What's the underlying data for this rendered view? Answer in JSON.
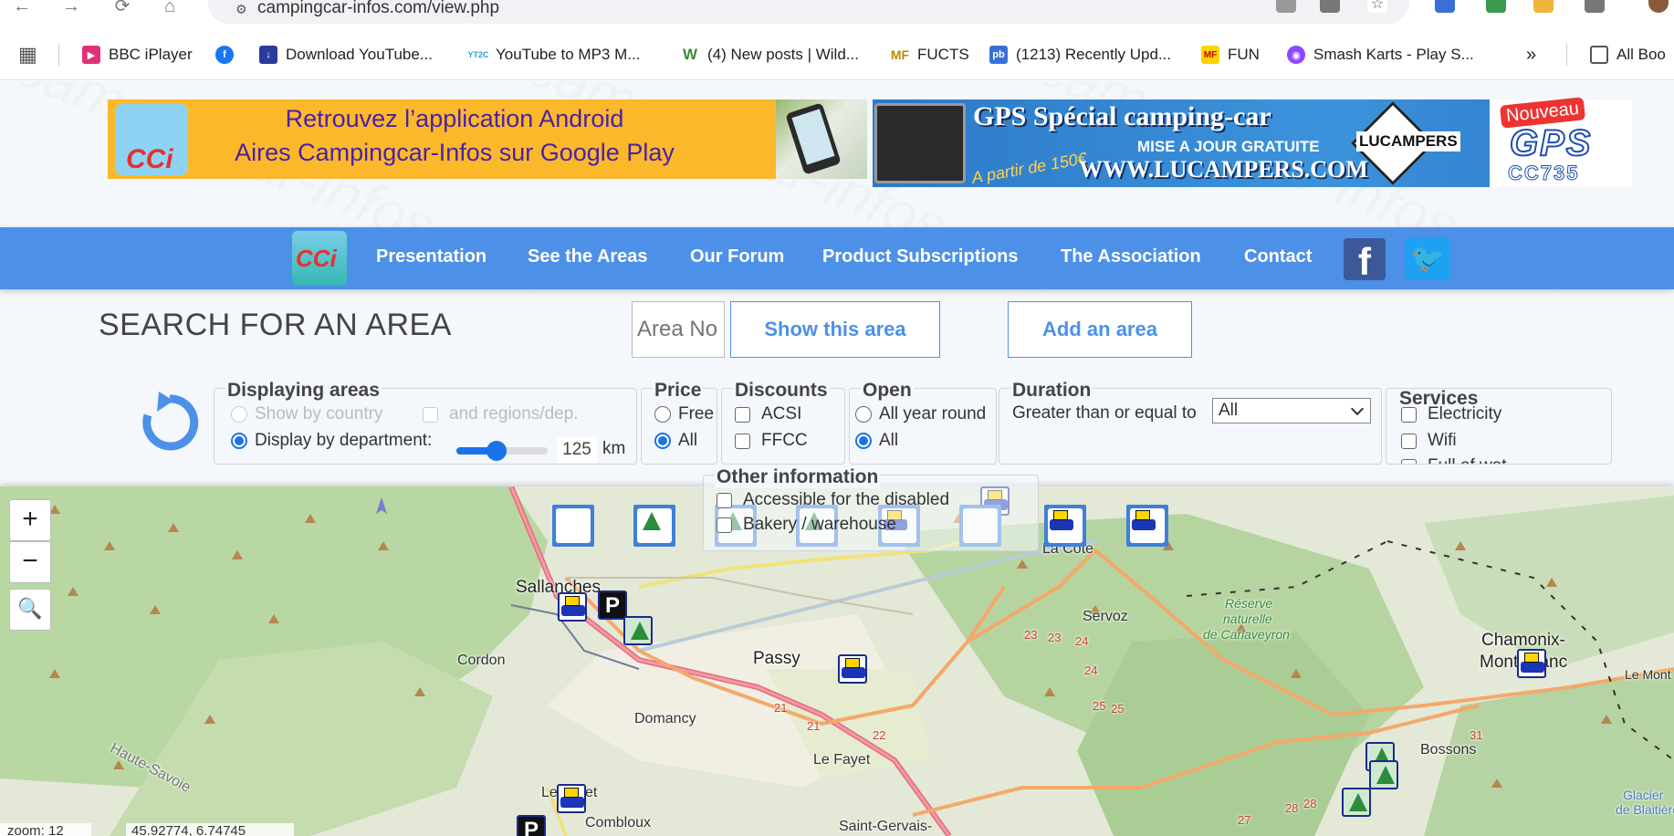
{
  "browser": {
    "url": "campingcar-infos.com/view.php",
    "bookmarks": [
      {
        "label": "BBC iPlayer",
        "icon": "bbc-iplayer-icon"
      },
      {
        "label": "Download YouTube...",
        "icon": "download-icon"
      },
      {
        "label": "YouTube to MP3 M...",
        "icon": "yt2c-icon",
        "badge": "YT2C"
      },
      {
        "label": "(4) New posts | Wild...",
        "icon": "w-icon",
        "badge": "W"
      },
      {
        "label": "FUCTS",
        "icon": "mf-icon",
        "badge": "MF"
      },
      {
        "label": "(1213) Recently Upd...",
        "icon": "pb-icon",
        "badge": "pb"
      },
      {
        "label": "FUN",
        "icon": "mf-icon",
        "badge": "MF"
      },
      {
        "label": "Smash Karts - Play S...",
        "icon": "twitch-icon"
      }
    ],
    "all_bookmarks": "All Boo"
  },
  "ads": {
    "android": {
      "line1": "Retrouvez l’application Android",
      "line2": "Aires Campingcar-Infos sur Google Play",
      "logo_text": "CCi"
    },
    "gps": {
      "title": "GPS Spécial camping-car",
      "update": "MISE A JOUR GRATUITE",
      "price": "A partir de 150€",
      "site": "WWW.LUCAMPERS.COM",
      "brand": "LUCAMPERS",
      "new": "Nouveau",
      "gps": "GPS",
      "model": "CC735"
    }
  },
  "nav": {
    "logo_text": "CCi",
    "links": [
      "Presentation",
      "See the Areas",
      "Our Forum",
      "Product Subscriptions",
      "The Association",
      "Contact"
    ],
    "facebook": "f",
    "twitter": "🐦"
  },
  "search": {
    "title": "SEARCH FOR AN AREA",
    "placeholder": "Area No",
    "show_button": "Show this area",
    "add_button": "Add an area"
  },
  "filters": {
    "displaying": {
      "legend": "Displaying areas",
      "by_country": "Show by country",
      "regions": "and regions/dep.",
      "by_department": "Display by department:",
      "km_value": "125",
      "km_unit": "km",
      "radius_fraction": 0.44
    },
    "price": {
      "legend": "Price",
      "free": "Free",
      "all": "All"
    },
    "discounts": {
      "legend": "Discounts",
      "acsi": "ACSI",
      "ffcc": "FFCC"
    },
    "open": {
      "legend": "Open",
      "all_year": "All year round",
      "all": "All"
    },
    "duration": {
      "legend": "Duration",
      "label": "Greater than or equal to",
      "value": "All"
    },
    "services": {
      "legend": "Services",
      "electricity": "Electricity",
      "wifi": "Wifi",
      "extra": "Full of wat"
    },
    "other": {
      "legend": "Other information",
      "disabled": "Accessible for the disabled",
      "bakery": "Bakery / warehouse"
    }
  },
  "map": {
    "zoom_in": "+",
    "zoom_out": "−",
    "search_icon": "🔍",
    "places": [
      "Sallanches",
      "Passy",
      "Cordon",
      "Domancy",
      "Le Fayet",
      "Le Cruet",
      "Combloux",
      "Saint-Gervais-",
      "Servoz",
      "Chamonix-",
      "Mont-Blanc",
      "Bossons",
      "La Côte",
      "Haute-Savoie",
      "Le Mont",
      "Glacier",
      "de Blaitière"
    ],
    "reserve": [
      "Réserve",
      "naturelle",
      "de Carlaveyron"
    ],
    "roads": [
      "21",
      "21",
      "22",
      "23",
      "23",
      "24",
      "24",
      "25",
      "25",
      "27",
      "28",
      "28",
      "31"
    ],
    "zoom_label": "zoom: 12",
    "coords": "45.92774, 6.74745"
  }
}
